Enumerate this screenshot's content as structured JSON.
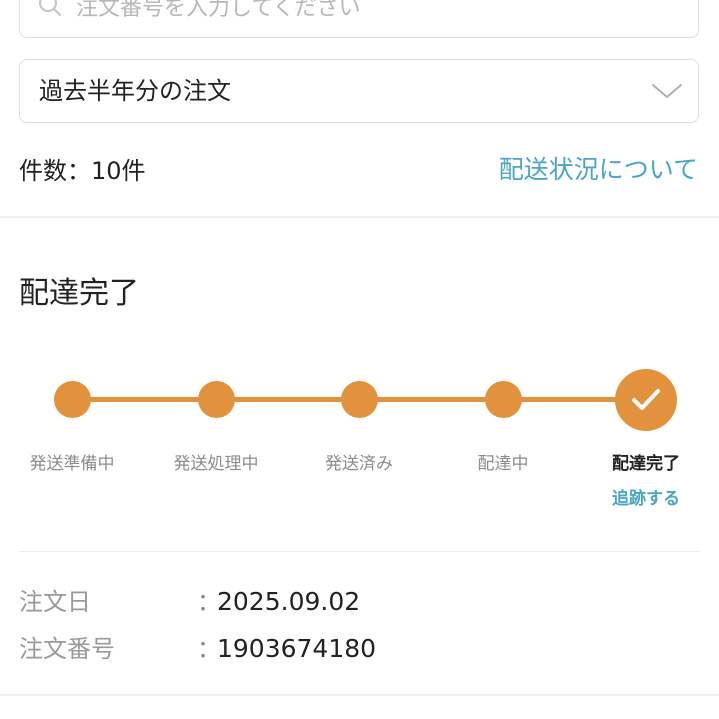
{
  "search": {
    "placeholder": "注文番号を入力してください"
  },
  "filter": {
    "period_selected": "過去半年分の注文"
  },
  "summary": {
    "count_label": "件数：10件",
    "shipping_info_link": "配送状況について"
  },
  "order": {
    "status_title": "配達完了",
    "progress": {
      "steps": [
        {
          "label": "発送準備中",
          "state": "done"
        },
        {
          "label": "発送処理中",
          "state": "done"
        },
        {
          "label": "発送済み",
          "state": "done"
        },
        {
          "label": "配達中",
          "state": "done"
        },
        {
          "label": "配達完了",
          "state": "current"
        }
      ],
      "track_link": "追跡する",
      "accent_color": "#e2923c"
    },
    "details": {
      "order_date_label": "注文日",
      "order_date_value": "2025.09.02",
      "order_number_label": "注文番号",
      "order_number_value": "1903674180",
      "separator": "："
    }
  },
  "colors": {
    "link": "#48a6c6",
    "accent": "#e2923c"
  },
  "icons": [
    "search-icon",
    "chevron-down-icon",
    "check-icon"
  ]
}
